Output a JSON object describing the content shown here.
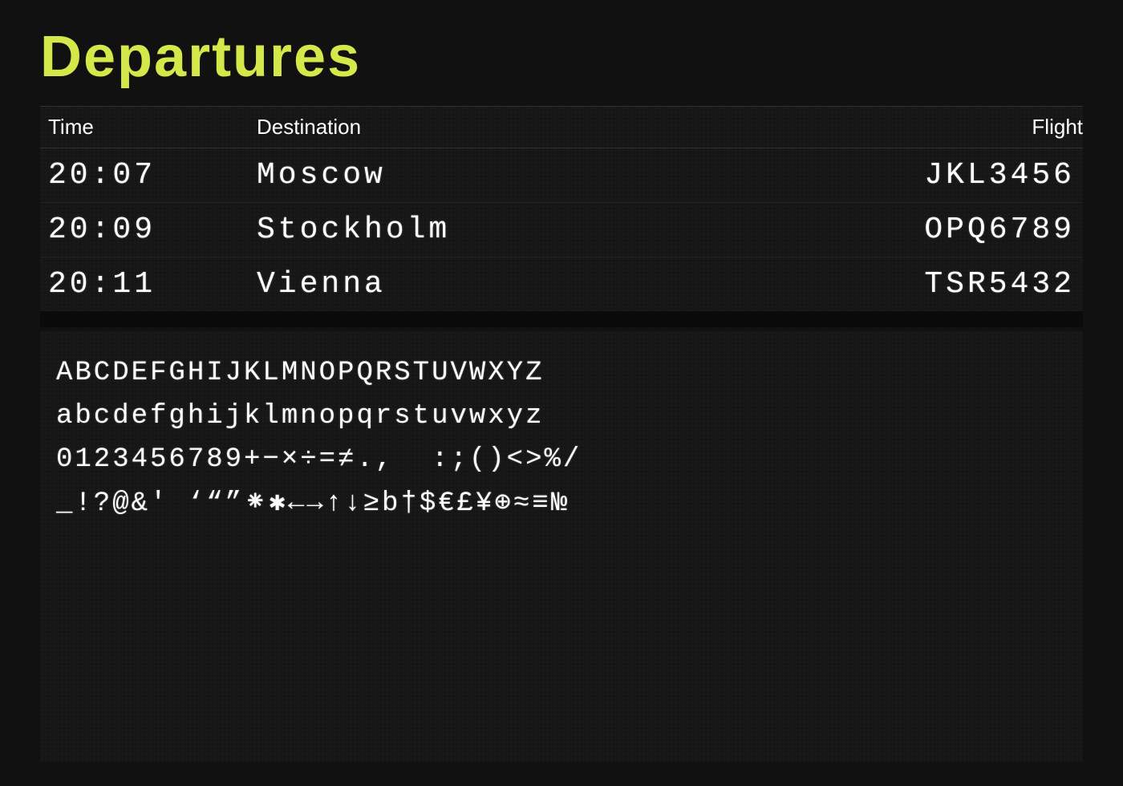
{
  "board": {
    "title": "Departures",
    "title_color": "#d4e84a",
    "background": "#111111",
    "columns": {
      "time": "Time",
      "destination": "Destination",
      "flight": "Flight"
    },
    "flights": [
      {
        "time": "20:07",
        "destination": "Moscow",
        "flight": "JKL3456"
      },
      {
        "time": "20:09",
        "destination": "Stockholm",
        "flight": "OPQ6789"
      },
      {
        "time": "20:11",
        "destination": "Vienna",
        "flight": "TSR5432"
      }
    ],
    "charset": {
      "uppercase": "ABCDEFGHIJKLMNOPQRSTUVWXYZ",
      "lowercase": "abcdefghijklmnopqrstuvwxyz",
      "numbers_symbols": "0123456789+-×÷=≠.,  :;()◁▷%/",
      "special": "_!?@&' '\"\"*❊←→↑↓≥b†$€£¥⊕≈≡#"
    }
  }
}
